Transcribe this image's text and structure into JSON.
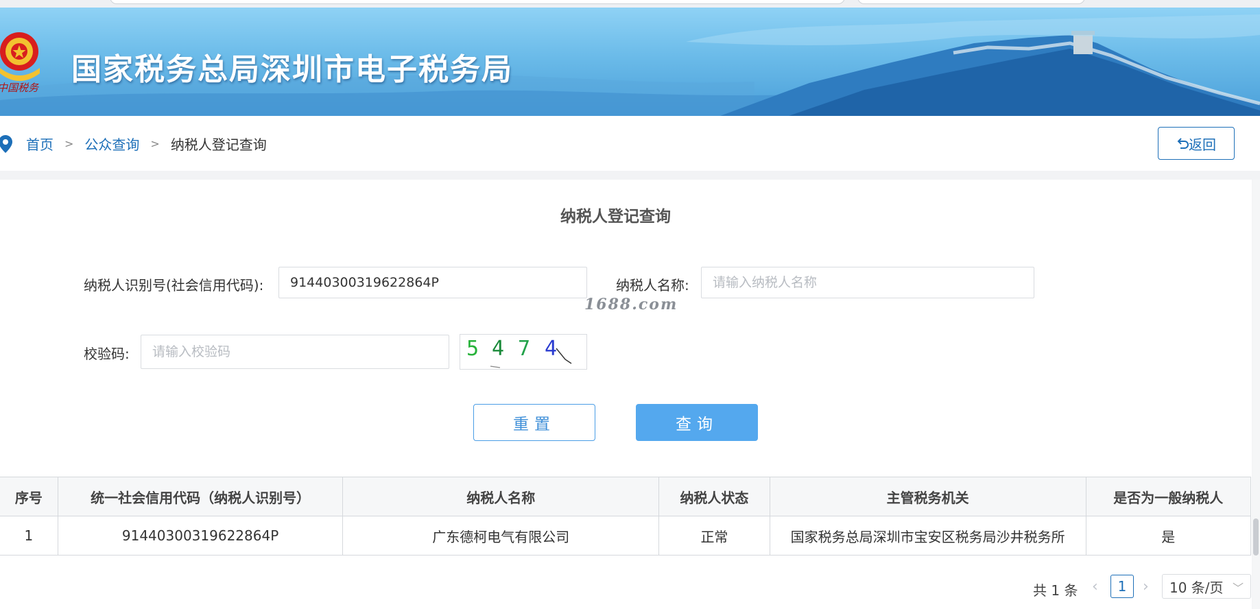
{
  "header": {
    "title": "国家税务总局深圳市电子税务局",
    "emblem_text": "中国税务"
  },
  "breadcrumb": {
    "home": "首页",
    "public_query": "公众查询",
    "current": "纳税人登记查询",
    "separator": ">"
  },
  "back_button": {
    "icon": "undo-arrow-icon",
    "label": "返回"
  },
  "form": {
    "title": "纳税人登记查询",
    "taxpayer_id": {
      "label": "纳税人识别号(社会信用代码):",
      "value": "91440300319622864P"
    },
    "taxpayer_name": {
      "label": "纳税人名称:",
      "value": "",
      "placeholder": "请输入纳税人名称"
    },
    "captcha": {
      "label": "校验码:",
      "value": "",
      "placeholder": "请输入校验码",
      "image_text": "5474"
    },
    "reset_label": "重置",
    "query_label": "查询"
  },
  "watermark": "1688.com",
  "table": {
    "headers": [
      "序号",
      "统一社会信用代码（纳税人识别号）",
      "纳税人名称",
      "纳税人状态",
      "主管税务机关",
      "是否为一般纳税人"
    ],
    "rows": [
      [
        "1",
        "91440300319622864P",
        "广东德柯电气有限公司",
        "正常",
        "国家税务总局深圳市宝安区税务局沙井税务所",
        "是"
      ]
    ]
  },
  "pagination": {
    "total": "共 1 条",
    "current_page": "1",
    "page_size": "10 条/页"
  },
  "colors": {
    "primary": "#1d6fb8",
    "query_button": "#54a8ee",
    "banner_sky": "#6bbbe9"
  }
}
